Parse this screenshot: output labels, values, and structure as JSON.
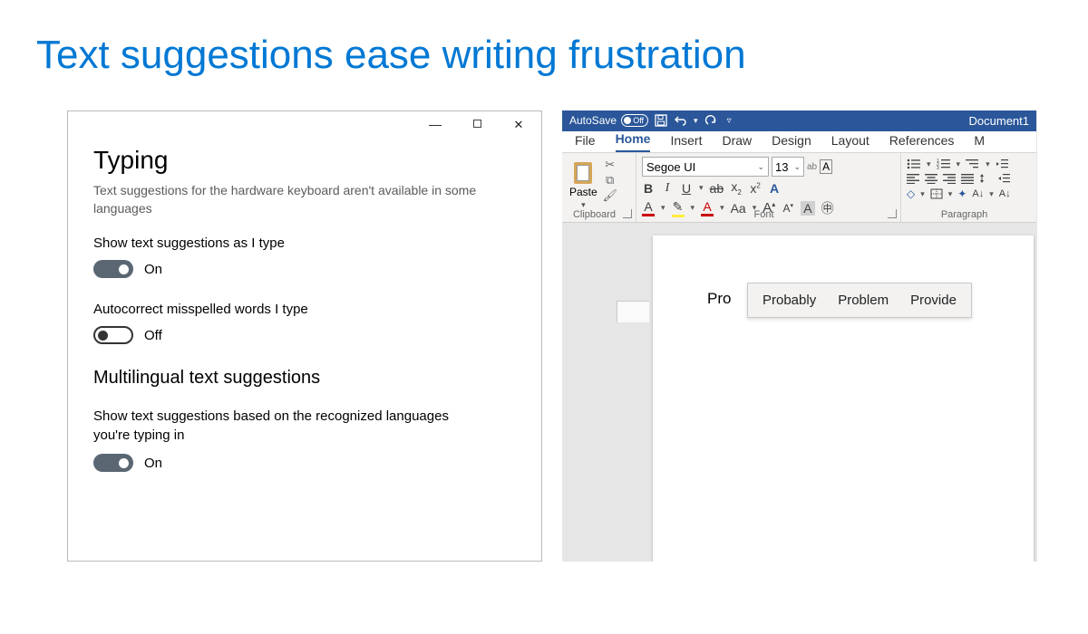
{
  "page_title": "Text suggestions ease writing frustration",
  "settings": {
    "heading": "Typing",
    "subtitle": "Text suggestions for the hardware keyboard aren't available in some languages",
    "toggle1_label": "Show text suggestions as I type",
    "toggle1_state": "On",
    "toggle2_label": "Autocorrect misspelled words I type",
    "toggle2_state": "Off",
    "section2": "Multilingual text suggestions",
    "toggle3_label": "Show text suggestions based on the recognized languages you're typing in",
    "toggle3_state": "On"
  },
  "word": {
    "autosave_label": "AutoSave",
    "autosave_state": "Off",
    "document_name": "Document1",
    "tabs": {
      "file": "File",
      "home": "Home",
      "insert": "Insert",
      "draw": "Draw",
      "design": "Design",
      "layout": "Layout",
      "references": "References",
      "more": "M"
    },
    "paste_label": "Paste",
    "group_clipboard": "Clipboard",
    "group_font": "Font",
    "group_paragraph": "Paragraph",
    "font_name": "Segoe UI",
    "font_size": "13",
    "typed": "Pro",
    "suggestions": [
      "Probably",
      "Problem",
      "Provide"
    ]
  }
}
